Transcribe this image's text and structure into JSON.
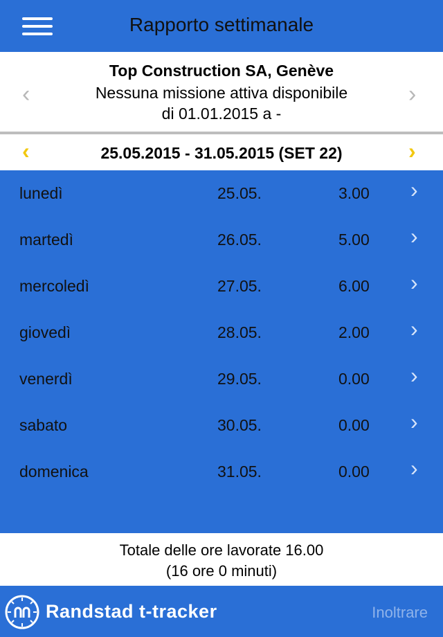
{
  "header": {
    "title": "Rapporto settimanale",
    "menu_icon": "hamburger-menu-icon"
  },
  "assignment": {
    "company": "Top Construction SA, Genève",
    "status": "Nessuna missione attiva disponibile",
    "period": "di 01.01.2015 a -",
    "prev_icon": "chevron-left-icon",
    "next_icon": "chevron-right-icon"
  },
  "week": {
    "label": "25.05.2015 - 31.05.2015 (SET 22)",
    "prev_icon": "chevron-left-icon",
    "next_icon": "chevron-right-icon",
    "arrow_color": "#f2c80f"
  },
  "days": [
    {
      "name": "lunedì",
      "date": "25.05.",
      "hours": "3.00"
    },
    {
      "name": "martedì",
      "date": "26.05.",
      "hours": "5.00"
    },
    {
      "name": "mercoledì",
      "date": "27.05.",
      "hours": "6.00"
    },
    {
      "name": "giovedì",
      "date": "28.05.",
      "hours": "2.00"
    },
    {
      "name": "venerdì",
      "date": "29.05.",
      "hours": "0.00"
    },
    {
      "name": "sabato",
      "date": "30.05.",
      "hours": "0.00"
    },
    {
      "name": "domenica",
      "date": "31.05.",
      "hours": "0.00"
    }
  ],
  "totals": {
    "line1": "Totale delle ore lavorate 16.00",
    "line2": "(16 ore 0 minuti)"
  },
  "footer": {
    "brand": "Randstad t-tracker",
    "send_label": "Inoltrare",
    "logo_icon": "randstad-clock-logo-icon"
  },
  "colors": {
    "primary_blue": "#2a6fd6",
    "accent_yellow": "#f2c80f"
  }
}
